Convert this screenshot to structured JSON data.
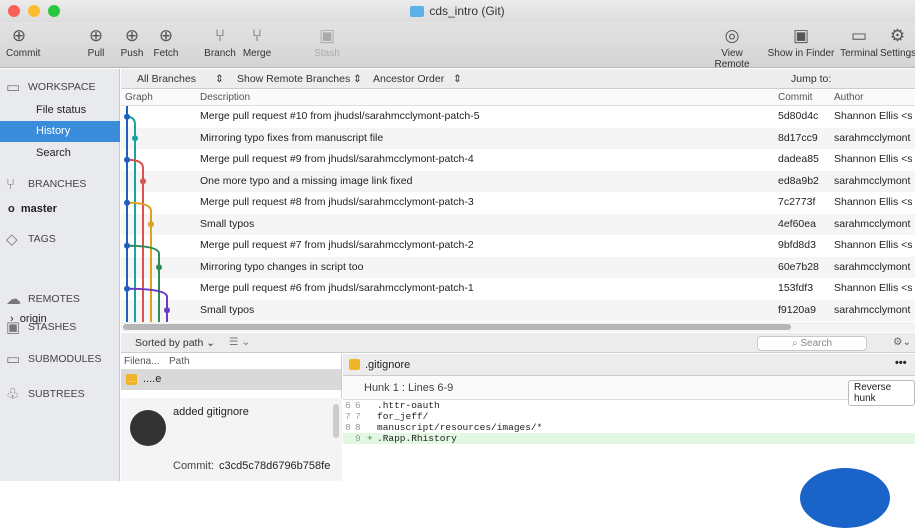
{
  "window": {
    "title": "cds_intro (Git)"
  },
  "toolbar": {
    "commit": "Commit",
    "pull": "Pull",
    "push": "Push",
    "fetch": "Fetch",
    "branch": "Branch",
    "merge": "Merge",
    "stash": "Stash",
    "view_remote": "View Remote",
    "show_in_finder": "Show in Finder",
    "terminal": "Terminal",
    "settings": "Settings"
  },
  "sidebar": {
    "workspace": "WORKSPACE",
    "file_status": "File status",
    "history": "History",
    "search": "Search",
    "branches": "BRANCHES",
    "master": "master",
    "tags": "TAGS",
    "remotes": "REMOTES",
    "origin": "origin",
    "stashes": "STASHES",
    "submodules": "SUBMODULES",
    "subtrees": "SUBTREES"
  },
  "filter": {
    "all_branches": "All Branches",
    "show_remote": "Show Remote Branches",
    "order": "Ancestor Order",
    "jump_to": "Jump to:"
  },
  "columns": {
    "graph": "Graph",
    "description": "Description",
    "commit": "Commit",
    "author": "Author"
  },
  "commits": [
    {
      "description": "Merge pull request #10 from jhudsl/sarahmcclymont-patch-5",
      "commit": "5d80d4c",
      "author": "Shannon Ellis <s"
    },
    {
      "description": "Mirroring typo fixes from manuscript file",
      "commit": "8d17cc9",
      "author": "sarahmcclymont"
    },
    {
      "description": "Merge pull request #9 from jhudsl/sarahmcclymont-patch-4",
      "commit": "dadea85",
      "author": "Shannon Ellis <s"
    },
    {
      "description": "One more typo and a missing image link fixed",
      "commit": "ed8a9b2",
      "author": "sarahmcclymont"
    },
    {
      "description": "Merge pull request #8 from jhudsl/sarahmcclymont-patch-3",
      "commit": "7c2773f",
      "author": "Shannon Ellis <s"
    },
    {
      "description": "Small typos",
      "commit": "4ef60ea",
      "author": "sarahmcclymont"
    },
    {
      "description": "Merge pull request #7 from jhudsl/sarahmcclymont-patch-2",
      "commit": "9bfd8d3",
      "author": "Shannon Ellis <s"
    },
    {
      "description": "Mirroring typo changes in script too",
      "commit": "60e7b28",
      "author": "sarahmcclymont"
    },
    {
      "description": "Merge pull request #6 from jhudsl/sarahmcclymont-patch-1",
      "commit": "153fdf3",
      "author": "Shannon Ellis <s"
    },
    {
      "description": "Small typos",
      "commit": "f9120a9",
      "author": "sarahmcclymont"
    }
  ],
  "lower": {
    "sort": "Sorted by path",
    "search_placeholder": "Search"
  },
  "files": {
    "col_filename": "Filena...",
    "col_path": "Path",
    "file": "....e"
  },
  "commit_detail": {
    "message": "added gitignore",
    "commit_label": "Commit:",
    "commit_hash": "c3cd5c78d6796b758fe"
  },
  "diff": {
    "filename": ".gitignore",
    "hunk": "Hunk 1 : Lines 6-9",
    "reverse": "Reverse hunk",
    "lines": [
      {
        "old": "6",
        "new": "6",
        "sign": "",
        "text": ".httr-oauth"
      },
      {
        "old": "7",
        "new": "7",
        "sign": "",
        "text": "for_jeff/"
      },
      {
        "old": "8",
        "new": "8",
        "sign": "",
        "text": "manuscript/resources/images/*"
      },
      {
        "old": "",
        "new": "9",
        "sign": "+",
        "text": ".Rapp.Rhistory"
      }
    ]
  },
  "colors": {
    "accent": "#3b8ddc",
    "graph": [
      "#1f5fbf",
      "#1aa3a3",
      "#d9534f",
      "#e0a020",
      "#2e8b57",
      "#6a3cc0"
    ]
  }
}
